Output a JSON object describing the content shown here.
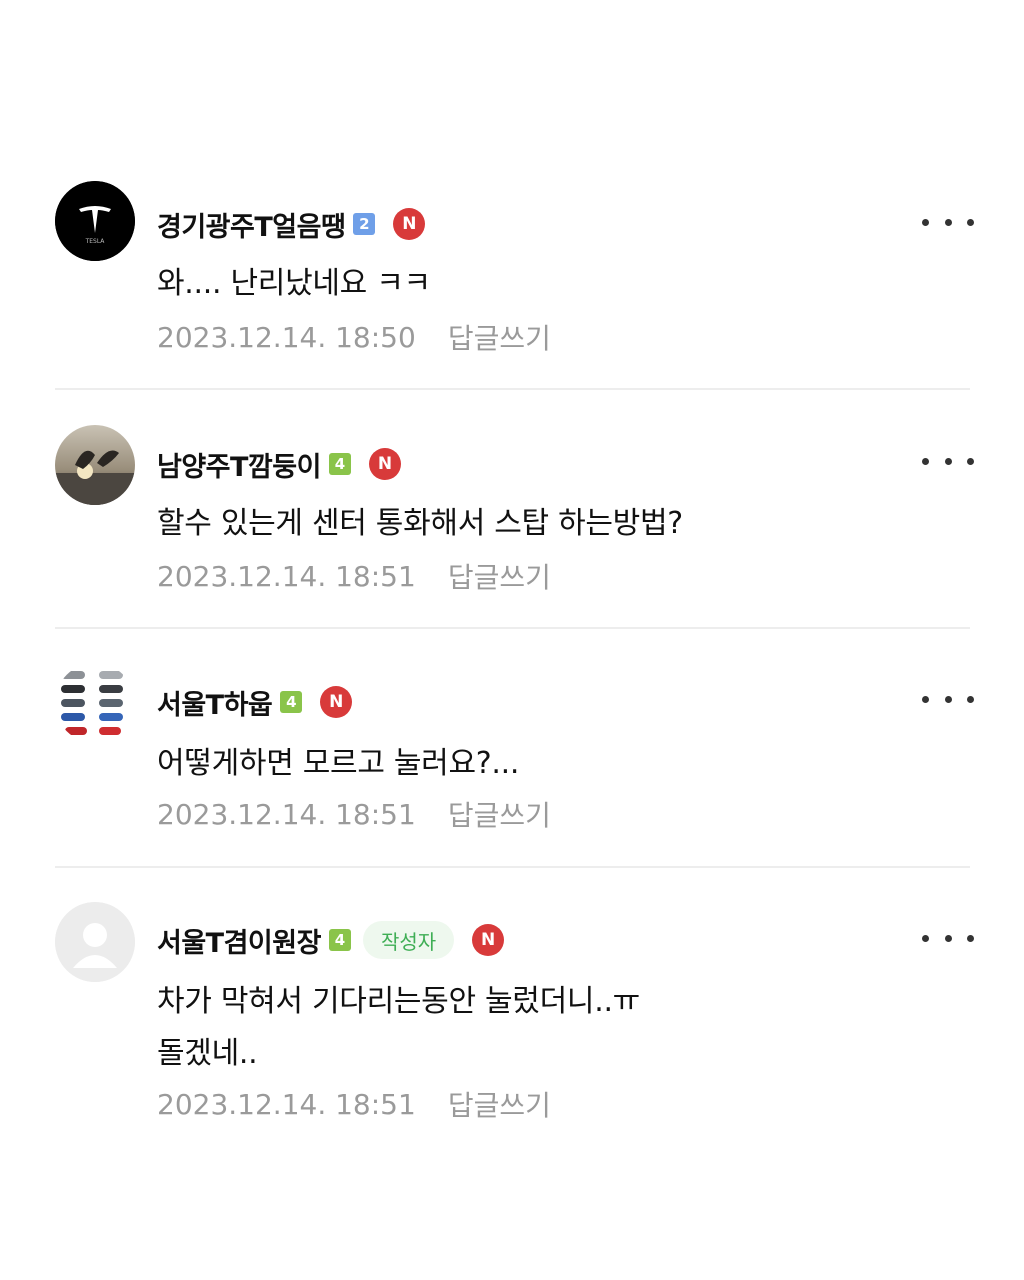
{
  "comments": [
    {
      "author": "경기광주T얼음땡",
      "level": "2",
      "new_badge": "N",
      "text": "와.... 난리났네요 ㅋㅋ",
      "date": "2023.12.14. 18:50",
      "reply": "답글쓰기",
      "avatar_label": "TESLA"
    },
    {
      "author": "남양주T깜둥이",
      "level": "4",
      "new_badge": "N",
      "text": "할수 있는게 센터 통화해서 스탑 하는방법?",
      "date": "2023.12.14. 18:51",
      "reply": "답글쓰기"
    },
    {
      "author": "서울T하웁",
      "level": "4",
      "new_badge": "N",
      "text": "어떻게하면 모르고 눌러요?...",
      "date": "2023.12.14. 18:51",
      "reply": "답글쓰기"
    },
    {
      "author": "서울T겸이원장",
      "level": "4",
      "writer_badge": "작성자",
      "new_badge": "N",
      "text": "차가 막혀서 기다리는동안 눌렀더니..ㅠ\n돌겠네..",
      "date": "2023.12.14. 18:51",
      "reply": "답글쓰기"
    }
  ],
  "colors": {
    "meta_gray": "#9a9a9a",
    "new_badge_red": "#d83a3a",
    "level2_blue": "#6f9fe8",
    "level4_green": "#8ac44a",
    "writer_green": "#3fae55"
  }
}
